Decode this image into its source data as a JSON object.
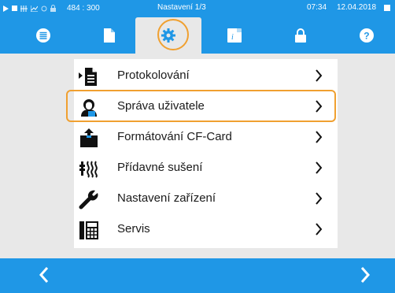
{
  "colors": {
    "accent": "#1f97e6",
    "highlight": "#f0a030",
    "background": "#e8e8e8",
    "panel": "#ffffff"
  },
  "status_bar": {
    "icons": [
      "play-icon",
      "stop-icon",
      "hatch-icon",
      "graph-icon",
      "circle-icon",
      "lock-icon"
    ],
    "coords": "484 : 300",
    "title": "Nastavení 1/3",
    "time": "07:34",
    "date": "12.04.2018"
  },
  "tabs": [
    {
      "icon": "list-icon",
      "active": false
    },
    {
      "icon": "document-icon",
      "active": false
    },
    {
      "icon": "gear-icon",
      "active": true
    },
    {
      "icon": "info-book-icon",
      "active": false
    },
    {
      "icon": "lock-icon",
      "active": false
    },
    {
      "icon": "help-icon",
      "active": false
    }
  ],
  "menu": {
    "items": [
      {
        "label": "Protokolování",
        "icon": "protocol-icon"
      },
      {
        "label": "Správa uživatele",
        "icon": "user-icon",
        "highlighted": true
      },
      {
        "label": "Formátování CF-Card",
        "icon": "cf-card-format-icon"
      },
      {
        "label": "Přídavné sušení",
        "icon": "drying-icon"
      },
      {
        "label": "Nastavení zařízení",
        "icon": "wrench-icon"
      },
      {
        "label": "Servis",
        "icon": "service-icon"
      }
    ]
  },
  "bottom_bar": {
    "back_icon": "chevron-left-icon",
    "forward_icon": "chevron-right-icon"
  }
}
